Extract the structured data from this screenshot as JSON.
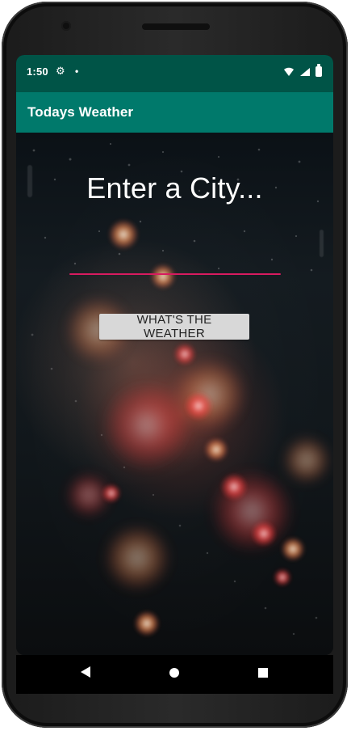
{
  "status_bar": {
    "time": "1:50",
    "settings_glyph": "⚙",
    "notification_dot": "•",
    "icons": [
      "wifi-icon",
      "signal-icon",
      "battery-icon"
    ]
  },
  "app_bar": {
    "title": "Todays Weather"
  },
  "main": {
    "prompt": "Enter a City...",
    "city_input": {
      "value": "",
      "placeholder": ""
    },
    "weather_button_label": "WHAT'S THE WEATHER"
  },
  "navigation": {
    "icons": [
      "back-icon",
      "home-icon",
      "recents-icon"
    ]
  },
  "colors": {
    "status_bar": "#005447",
    "app_bar": "#00796b",
    "input_underline": "#d81b60",
    "button_bg": "#d8d8d8"
  }
}
